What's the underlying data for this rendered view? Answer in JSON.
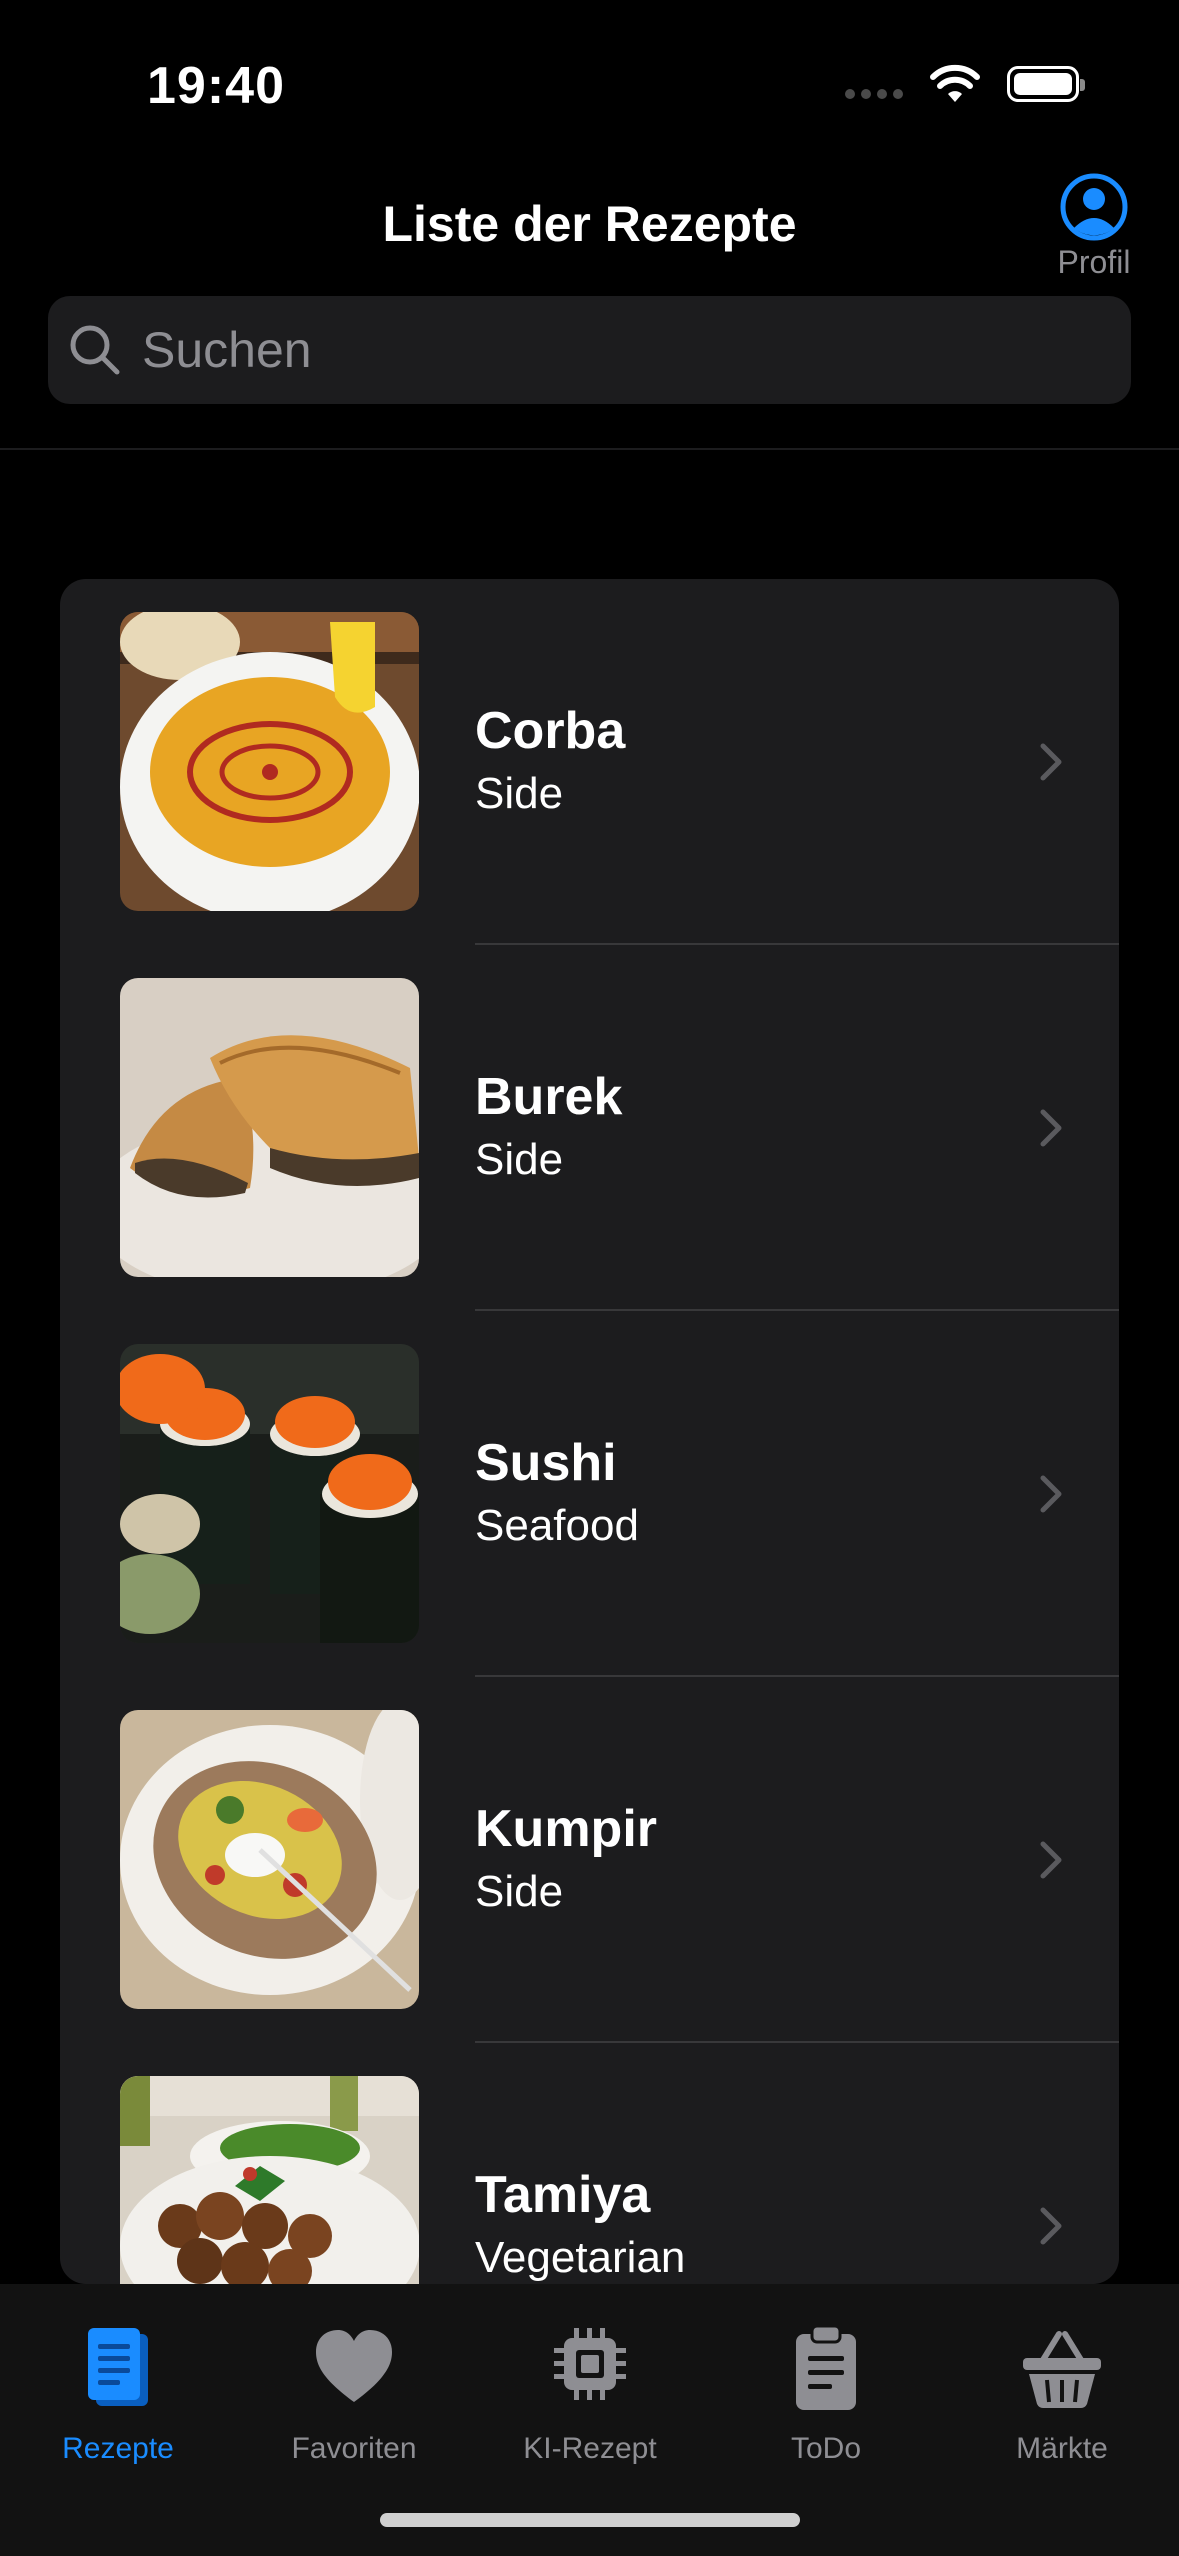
{
  "status_bar": {
    "time": "19:40"
  },
  "nav": {
    "title": "Liste der Rezepte",
    "profile_label": "Profil"
  },
  "search": {
    "placeholder": "Suchen"
  },
  "recipes": [
    {
      "name": "Corba",
      "category": "Side"
    },
    {
      "name": "Burek",
      "category": "Side"
    },
    {
      "name": "Sushi",
      "category": "Seafood"
    },
    {
      "name": "Kumpir",
      "category": "Side"
    },
    {
      "name": "Tamiya",
      "category": "Vegetarian"
    }
  ],
  "tabbar": {
    "tabs": [
      {
        "label": "Rezepte",
        "icon": "book-icon",
        "active": true
      },
      {
        "label": "Favoriten",
        "icon": "heart-icon",
        "active": false
      },
      {
        "label": "KI-Rezept",
        "icon": "cpu-icon",
        "active": false
      },
      {
        "label": "ToDo",
        "icon": "clipboard-icon",
        "active": false
      },
      {
        "label": "Märkte",
        "icon": "basket-icon",
        "active": false
      }
    ]
  },
  "colors": {
    "accent": "#1a8cff",
    "background": "#000000",
    "card": "#1c1c1e",
    "secondary_text": "#8e8e93"
  }
}
